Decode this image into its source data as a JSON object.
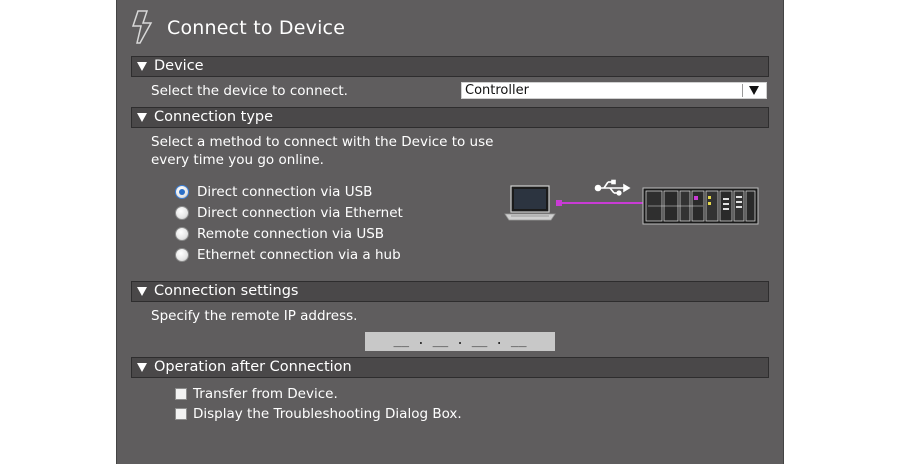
{
  "dialog": {
    "title": "Connect to Device",
    "title_icon": "lightning-bolt-icon"
  },
  "device_section": {
    "header": "Device",
    "prompt": "Select the device to connect.",
    "selected_device": "Controller"
  },
  "connection_type_section": {
    "header": "Connection type",
    "description_line1": "Select a method to connect with the Device to use",
    "description_line2": "every time you go online.",
    "options": [
      {
        "label": "Direct connection via USB",
        "selected": true
      },
      {
        "label": "Direct connection via Ethernet",
        "selected": false
      },
      {
        "label": "Remote connection via USB",
        "selected": false
      },
      {
        "label": "Ethernet connection via a hub",
        "selected": false
      }
    ],
    "diagram_icons": [
      "laptop-icon",
      "usb-icon",
      "controller-unit-icon"
    ]
  },
  "connection_settings_section": {
    "header": "Connection settings",
    "prompt": "Specify the remote IP address.",
    "ip_address_value": "__ . __ . __ . __"
  },
  "operation_section": {
    "header": "Operation after Connection",
    "checkboxes": [
      {
        "label": "Transfer from Device.",
        "checked": false
      },
      {
        "label": "Display the Troubleshooting Dialog Box.",
        "checked": false
      }
    ]
  },
  "colors": {
    "panel_background": "#5f5d5e",
    "section_header_background": "#4a4849",
    "usb_link_color": "#c93bd6",
    "selected_radio": "#2a6fc9"
  }
}
